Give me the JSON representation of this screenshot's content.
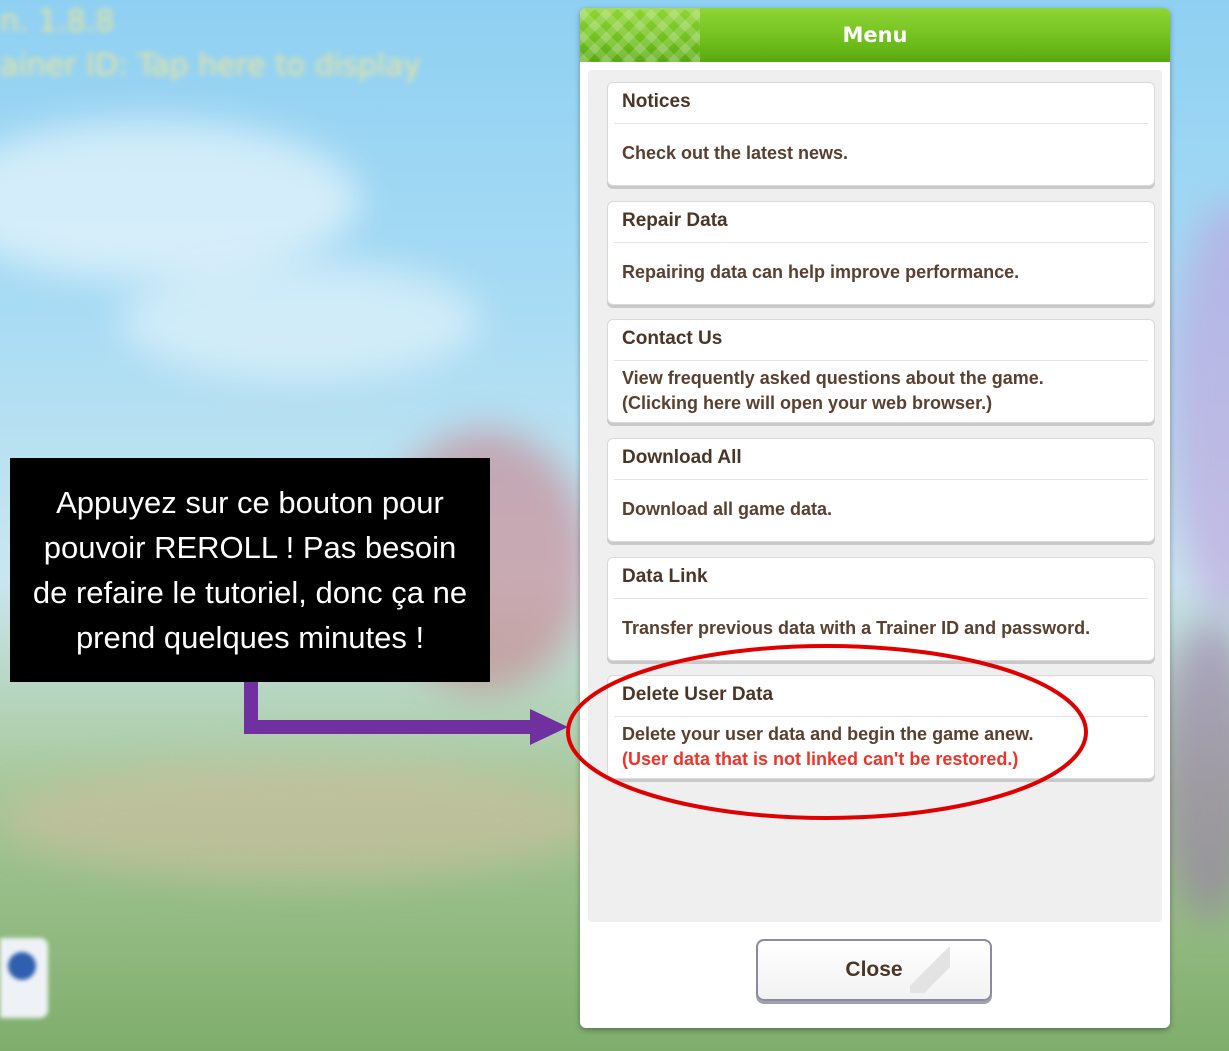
{
  "background": {
    "version_line": "n. 1.8.8",
    "trainer_line": "ainer ID: Tap here to display"
  },
  "callout": {
    "text": "Appuyez sur ce bouton pour pouvoir REROLL ! Pas besoin de refaire le tutoriel, donc ça ne prend quelques minutes !"
  },
  "menu": {
    "title": "Menu",
    "items": [
      {
        "title": "Notices",
        "desc": "Check out the latest news.",
        "warn": ""
      },
      {
        "title": "Repair Data",
        "desc": "Repairing data can help improve performance.",
        "warn": ""
      },
      {
        "title": "Contact Us",
        "desc": "View frequently asked questions about the game.",
        "desc2": "(Clicking here will open your web browser.)",
        "warn": ""
      },
      {
        "title": "Download All",
        "desc": "Download all game data.",
        "warn": ""
      },
      {
        "title": "Data Link",
        "desc": "Transfer previous data with a Trainer ID and password.",
        "warn": ""
      },
      {
        "title": "Delete User Data",
        "desc": "Delete your user data and begin the game anew.",
        "warn": "(User data that is not linked can't be restored.)"
      }
    ],
    "close_label": "Close"
  },
  "colors": {
    "header_green": "#6fbf1c",
    "highlight_red": "#e00000",
    "arrow_purple": "#7030a0",
    "warn_red": "#f0342a"
  }
}
